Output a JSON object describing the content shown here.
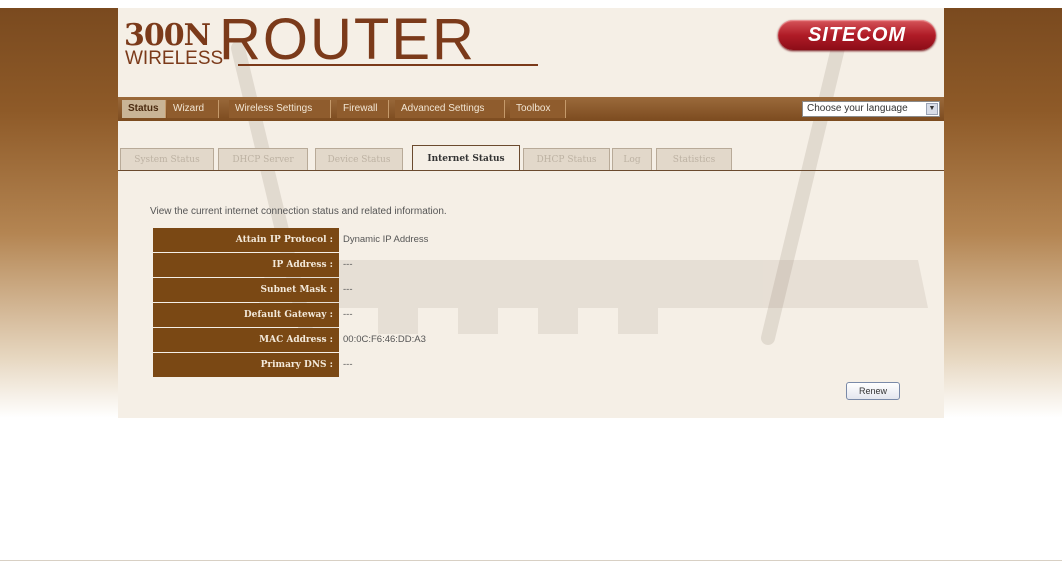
{
  "brand": {
    "logo_300n": "300N",
    "logo_wireless": "WIRELESS",
    "logo_router": "ROUTER",
    "company_logo": "SITECOM"
  },
  "menu": {
    "items": [
      {
        "label": "Status",
        "active": true
      },
      {
        "label": "Wizard"
      },
      {
        "label": "Wireless Settings"
      },
      {
        "label": "Firewall"
      },
      {
        "label": "Advanced Settings"
      },
      {
        "label": "Toolbox"
      }
    ],
    "language_select": "Choose your language"
  },
  "tabs": [
    {
      "label": "System Status"
    },
    {
      "label": "DHCP Server"
    },
    {
      "label": "Device Status"
    },
    {
      "label": "Internet Status",
      "active": true
    },
    {
      "label": "DHCP Status"
    },
    {
      "label": "Log"
    },
    {
      "label": "Statistics"
    }
  ],
  "content": {
    "intro": "View the current internet connection status and related information.",
    "rows": [
      {
        "label": "Attain IP Protocol :",
        "value": "Dynamic IP Address"
      },
      {
        "label": "IP Address :",
        "value": "---"
      },
      {
        "label": "Subnet Mask :",
        "value": "---"
      },
      {
        "label": "Default Gateway :",
        "value": "---"
      },
      {
        "label": "MAC Address :",
        "value": "00:0C:F6:46:DD:A3"
      },
      {
        "label": "Primary DNS :",
        "value": "---"
      }
    ],
    "renew_button": "Renew"
  },
  "colors": {
    "brand_brown": "#7b3a1a",
    "label_bg": "#7a4814",
    "sitecom_red": "#b01c27",
    "panel_bg": "#f5efe6"
  }
}
